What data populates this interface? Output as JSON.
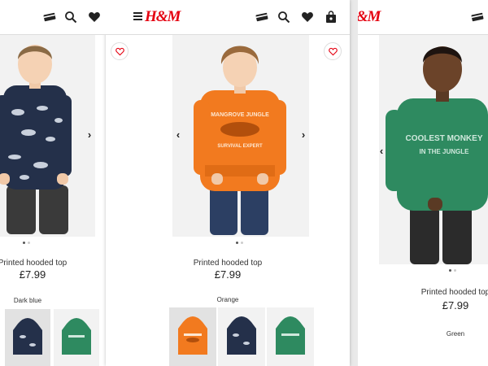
{
  "brand": {
    "logo": "H&M",
    "accent": "#e50010"
  },
  "header": {
    "icons": [
      "credit-card-icon",
      "search-icon",
      "heart-icon",
      "shopping-bag-icon"
    ],
    "menu_icon": "menu-icon"
  },
  "products": [
    {
      "name": "Printed hooded top",
      "price": "£7.99",
      "color_label": "Dark blue",
      "hoodie_color": "#24304a",
      "swatches": [
        "#24304a",
        "#2e8a60"
      ],
      "carousel_dots": 2
    },
    {
      "name": "Printed hooded top",
      "price": "£7.99",
      "color_label": "Orange",
      "hoodie_color": "#f27a1f",
      "print_lines": [
        "MANGROVE JUNGLE",
        "SURVIVAL EXPERT"
      ],
      "swatches": [
        "#f27a1f",
        "#24304a",
        "#2e8a60"
      ],
      "carousel_dots": 2
    },
    {
      "name": "Printed hooded top",
      "price": "£7.99",
      "color_label": "Green",
      "hoodie_color": "#2e8a60",
      "print_lines": [
        "COOLEST MONKEY",
        "IN THE JUNGLE"
      ],
      "carousel_dots": 2
    }
  ]
}
